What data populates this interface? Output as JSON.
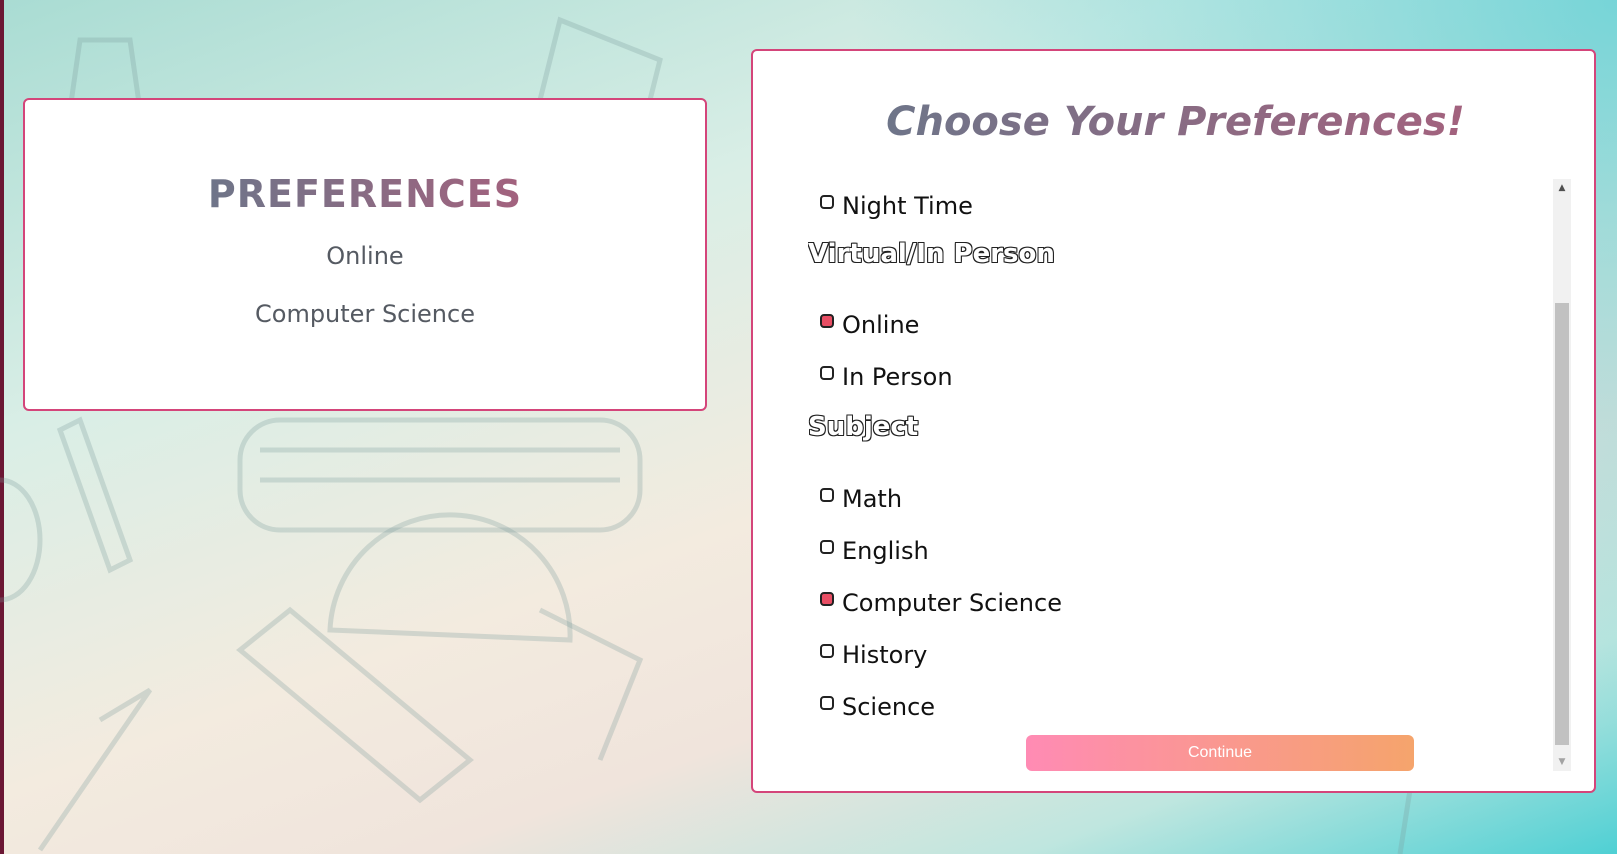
{
  "summary": {
    "title": "PREFERENCES",
    "items": [
      "Online",
      "Computer Science"
    ]
  },
  "preferences": {
    "title": "Choose Your Preferences!",
    "partial_option": {
      "label": "Night Time",
      "checked": false
    },
    "groups": [
      {
        "title": "Virtual/In Person",
        "options": [
          {
            "label": "Online",
            "checked": true
          },
          {
            "label": "In Person",
            "checked": false
          }
        ]
      },
      {
        "title": "Subject",
        "options": [
          {
            "label": "Math",
            "checked": false
          },
          {
            "label": "English",
            "checked": false
          },
          {
            "label": "Computer Science",
            "checked": true
          },
          {
            "label": "History",
            "checked": false
          },
          {
            "label": "Science",
            "checked": false
          }
        ]
      }
    ],
    "continue_label": "Continue"
  },
  "colors": {
    "card_border": "#d4457a",
    "checked_box": "#e84e64",
    "button_gradient_start": "#ff8bb4",
    "button_gradient_end": "#f5a46c"
  },
  "icons": {
    "scroll_up": "scroll-up-arrow-icon",
    "scroll_down": "scroll-down-arrow-icon"
  }
}
